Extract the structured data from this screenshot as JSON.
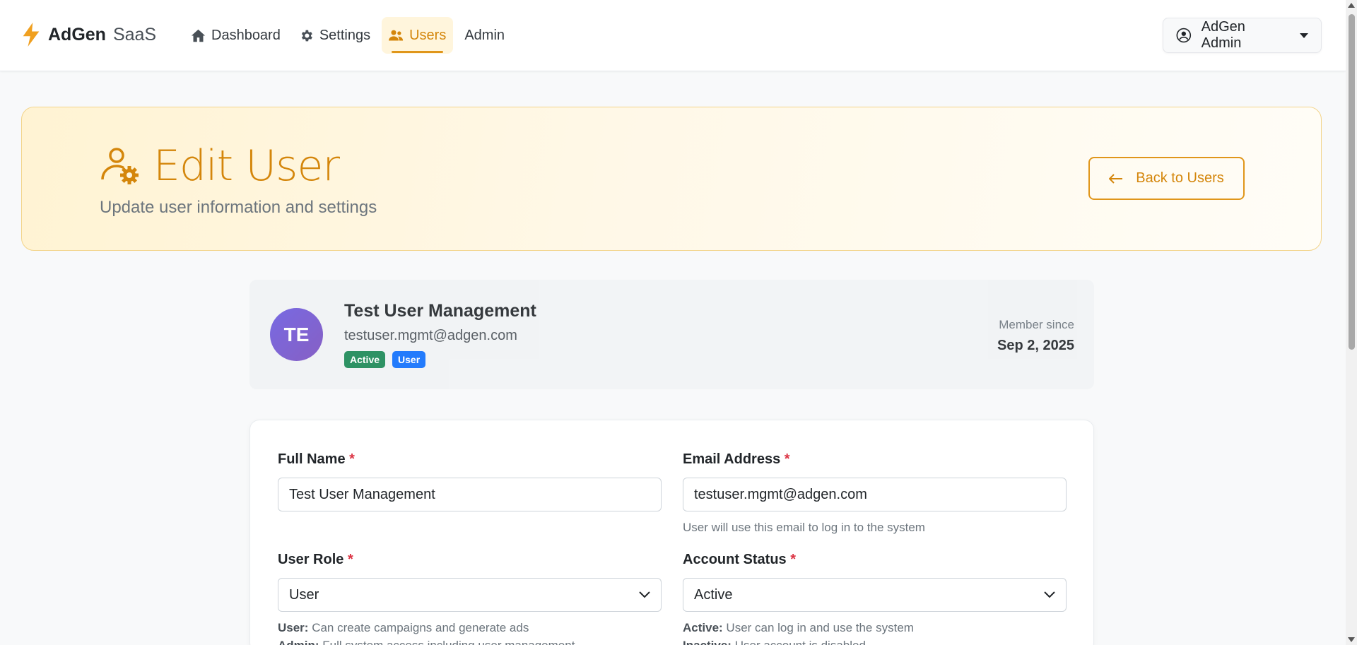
{
  "navbar": {
    "brand_bold": "AdGen",
    "brand_light": "SaaS",
    "items": [
      {
        "label": "Dashboard",
        "icon": "home-icon"
      },
      {
        "label": "Settings",
        "icon": "gear-icon"
      },
      {
        "label": "Users",
        "icon": "users-icon",
        "active": true
      },
      {
        "label": "Admin"
      }
    ],
    "user_menu_label": "AdGen Admin"
  },
  "hero": {
    "title": "Edit User",
    "subtitle": "Update user information and settings",
    "back_label": "Back to Users"
  },
  "summary": {
    "initials": "TE",
    "name": "Test User Management",
    "email": "testuser.mgmt@adgen.com",
    "badges": [
      "Active",
      "User"
    ],
    "member_label": "Member since",
    "member_date": "Sep 2, 2025"
  },
  "form": {
    "full_name": {
      "label": "Full Name",
      "required": "*",
      "value": "Test User Management"
    },
    "email": {
      "label": "Email Address",
      "required": "*",
      "value": "testuser.mgmt@adgen.com",
      "help": "User will use this email to log in to the system"
    },
    "role": {
      "label": "User Role",
      "required": "*",
      "selected": "User",
      "help": [
        {
          "term": "User:",
          "text": " Can create campaigns and generate ads"
        },
        {
          "term": "Admin:",
          "text": " Full system access including user management"
        }
      ]
    },
    "status": {
      "label": "Account Status",
      "required": "*",
      "selected": "Active",
      "help": [
        {
          "term": "Active:",
          "text": " User can log in and use the system"
        },
        {
          "term": "Inactive:",
          "text": " User account is disabled"
        }
      ]
    }
  },
  "colors": {
    "accent": "#d4860b",
    "success": "#198754",
    "primary": "#0d6efd",
    "danger": "#dc3545"
  }
}
